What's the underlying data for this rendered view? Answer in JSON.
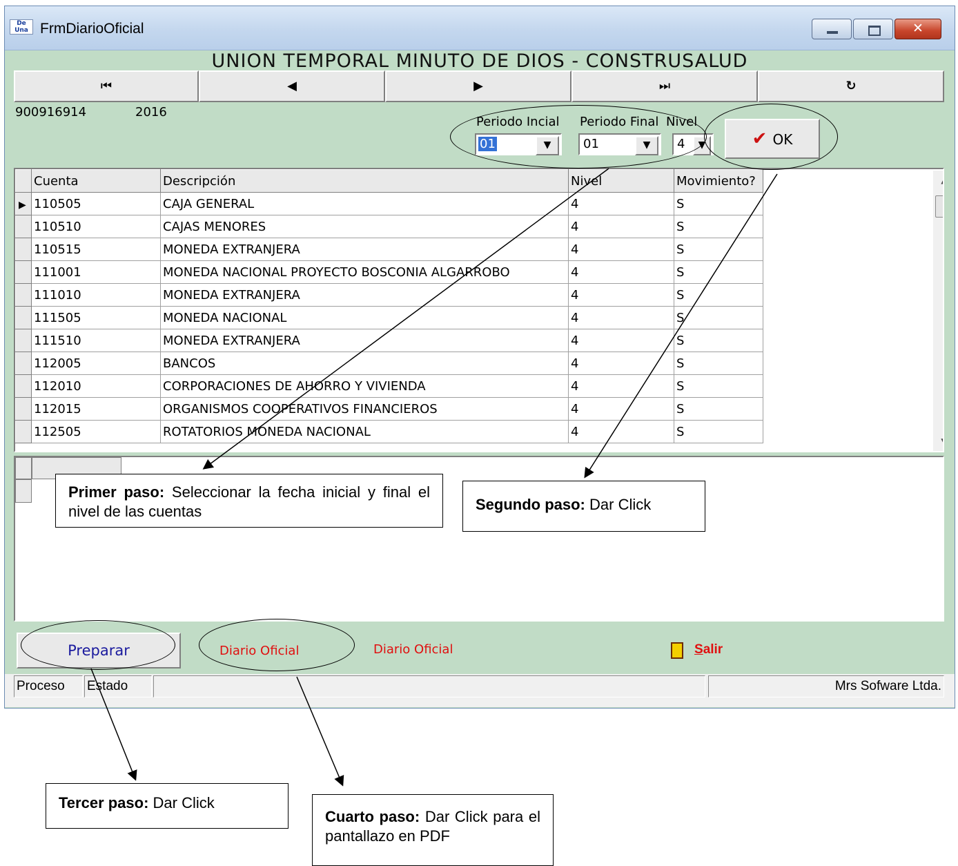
{
  "window": {
    "title": "FrmDiarioOficial",
    "app_icon_text": "De Una"
  },
  "header": {
    "company": "UNION TEMPORAL MINUTO DE DIOS - CONSTRUSALUD"
  },
  "nav": {
    "first": "⏮",
    "prev": "◀",
    "next": "▶",
    "last": "⏭",
    "refresh": "↻"
  },
  "info": {
    "nit": "900916914",
    "year": "2016"
  },
  "filters": {
    "periodo_inicial_label": "Periodo Incial",
    "periodo_final_label": "Periodo Final",
    "nivel_label": "Nivel",
    "periodo_inicial_value": "01",
    "periodo_final_value": "01",
    "nivel_value": "4",
    "ok_label": "OK"
  },
  "grid": {
    "columns": [
      "Cuenta",
      "Descripción",
      "Nivel",
      "Movimiento?"
    ],
    "rows": [
      [
        "110505",
        "CAJA GENERAL",
        "4",
        "S"
      ],
      [
        "110510",
        "CAJAS MENORES",
        "4",
        "S"
      ],
      [
        "110515",
        "MONEDA EXTRANJERA",
        "4",
        "S"
      ],
      [
        "111001",
        "MONEDA NACIONAL PROYECTO BOSCONIA ALGARROBO",
        "4",
        "S"
      ],
      [
        "111010",
        "MONEDA EXTRANJERA",
        "4",
        "S"
      ],
      [
        "111505",
        "MONEDA NACIONAL",
        "4",
        "S"
      ],
      [
        "111510",
        "MONEDA EXTRANJERA",
        "4",
        "S"
      ],
      [
        "112005",
        "BANCOS",
        "4",
        "S"
      ],
      [
        "112010",
        "CORPORACIONES DE AHORRO Y VIVIENDA",
        "4",
        "S"
      ],
      [
        "112015",
        "ORGANISMOS COOPERATIVOS FINANCIEROS",
        "4",
        "S"
      ],
      [
        "112505",
        "ROTATORIOS MONEDA NACIONAL",
        "4",
        "S"
      ]
    ]
  },
  "bottom": {
    "preparar": "Preparar",
    "diario_oficial_1": "Diario Oficial",
    "diario_oficial_2": "Diario Oficial",
    "salir_first": "S",
    "salir_rest": "alir"
  },
  "status": {
    "proceso": "Proceso",
    "estado": "Estado",
    "company": "Mrs Sofware Ltda."
  },
  "callouts": {
    "step1_bold": "Primer paso:",
    "step1_text": " Seleccionar la fecha inicial y final el nivel de las cuentas",
    "step2_bold": "Segundo paso:",
    "step2_text": " Dar Click",
    "step3_bold": "Tercer paso:",
    "step3_text": " Dar Click",
    "step4_bold": "Cuarto paso:",
    "step4_text": " Dar Click para el pantallazo en PDF"
  }
}
